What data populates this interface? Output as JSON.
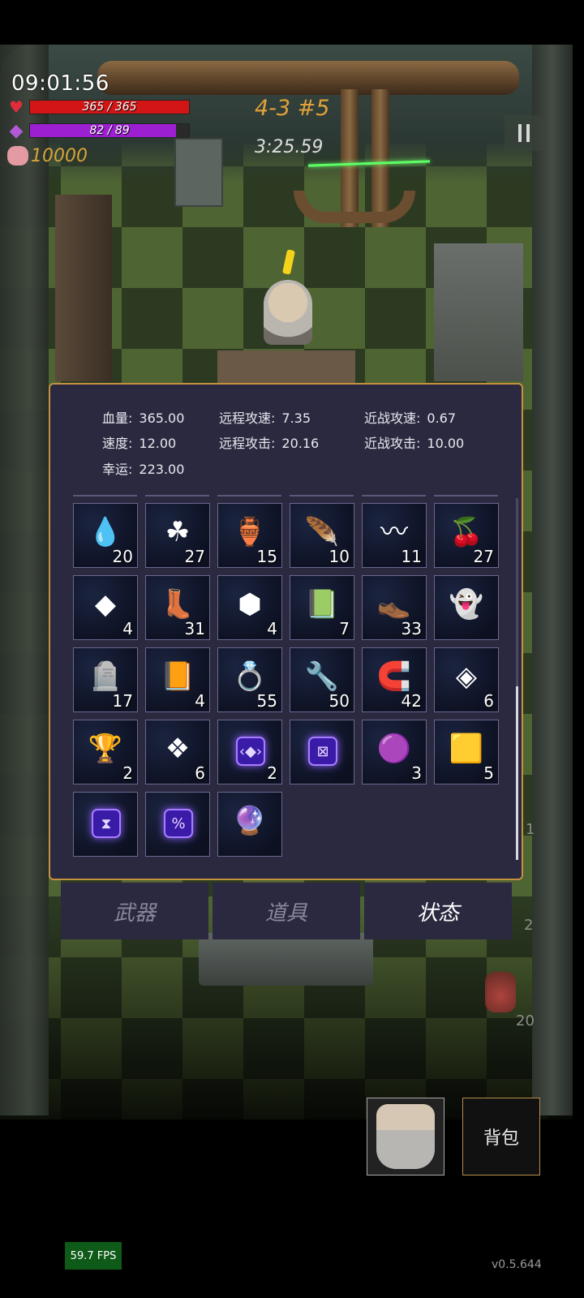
{
  "hud": {
    "clock": "09:01:56",
    "hp_text": "365 / 365",
    "hp_fraction": 1.0,
    "mp_text": "82 / 89",
    "mp_fraction": 0.92,
    "coins": "10000",
    "level": "4-3 #5",
    "timer": "3:25.59"
  },
  "status": {
    "stats": [
      {
        "label": "血量:",
        "value": "365.00"
      },
      {
        "label": "远程攻速:",
        "value": "7.35"
      },
      {
        "label": "近战攻速:",
        "value": "0.67"
      },
      {
        "label": "速度:",
        "value": "12.00"
      },
      {
        "label": "远程攻击:",
        "value": "20.16"
      },
      {
        "label": "近战攻击:",
        "value": "10.00"
      },
      {
        "label": "幸运:",
        "value": "223.00"
      }
    ],
    "items": [
      {
        "icon": "blue-drop-icon",
        "glyph": "💧",
        "count": "20"
      },
      {
        "icon": "clover-icon",
        "glyph": "☘",
        "count": "27"
      },
      {
        "icon": "red-jar-icon",
        "glyph": "🏺",
        "count": "15"
      },
      {
        "icon": "feather-icon",
        "glyph": "🪶",
        "count": "10"
      },
      {
        "icon": "worm-icon",
        "glyph": "〰",
        "count": "11"
      },
      {
        "icon": "berries-icon",
        "glyph": "🍒",
        "count": "27"
      },
      {
        "icon": "green-crystal-icon",
        "glyph": "◆",
        "count": "4"
      },
      {
        "icon": "boots-icon",
        "glyph": "👢",
        "count": "31"
      },
      {
        "icon": "cubes-icon",
        "glyph": "⬢",
        "count": "4"
      },
      {
        "icon": "skull-book-icon",
        "glyph": "📗",
        "count": "7"
      },
      {
        "icon": "sandals-icon",
        "glyph": "👞",
        "count": "33"
      },
      {
        "icon": "cloak-icon",
        "glyph": "👻",
        "count": ""
      },
      {
        "icon": "tombstone-icon",
        "glyph": "🪦",
        "count": "17"
      },
      {
        "icon": "sun-card-icon",
        "glyph": "📙",
        "count": "4"
      },
      {
        "icon": "ring-icon",
        "glyph": "💍",
        "count": "55"
      },
      {
        "icon": "wrench-icon",
        "glyph": "🔧",
        "count": "50"
      },
      {
        "icon": "horseshoe-icon",
        "glyph": "🧲",
        "count": "42"
      },
      {
        "icon": "diamond-tile-icon",
        "glyph": "◈",
        "count": "6"
      },
      {
        "icon": "star-trophy-icon",
        "glyph": "🏆",
        "count": "2"
      },
      {
        "icon": "ice-tile-icon",
        "glyph": "❖",
        "count": "6"
      },
      {
        "icon": "rune-code-icon",
        "glyph": "‹◆›",
        "count": "2",
        "rune": true
      },
      {
        "icon": "rune-cross-icon",
        "glyph": "⊠",
        "count": "",
        "rune": true
      },
      {
        "icon": "purple-slime-icon",
        "glyph": "🟣",
        "count": "3"
      },
      {
        "icon": "yellow-card-icon",
        "glyph": "🟨",
        "count": "5"
      },
      {
        "icon": "rune-hourglass-icon",
        "glyph": "⧗",
        "count": "",
        "rune": true
      },
      {
        "icon": "rune-percent-icon",
        "glyph": "%",
        "count": "",
        "rune": true
      },
      {
        "icon": "rainbow-orb-icon",
        "glyph": "🔮",
        "count": ""
      }
    ]
  },
  "tabs": [
    {
      "label": "武器"
    },
    {
      "label": "道具"
    },
    {
      "label": "状态"
    }
  ],
  "side_counts": [
    "1",
    "2",
    "20"
  ],
  "bottom": {
    "bag_label": "背包",
    "fps": "59.7 FPS",
    "version": "v0.5.644"
  },
  "colors": {
    "panel_bg": "#2b2940",
    "panel_border": "#c4913f",
    "hp": "#d21616",
    "mp": "#9d1fd2",
    "coins": "#d9a33a",
    "level": "#e0a23a"
  }
}
